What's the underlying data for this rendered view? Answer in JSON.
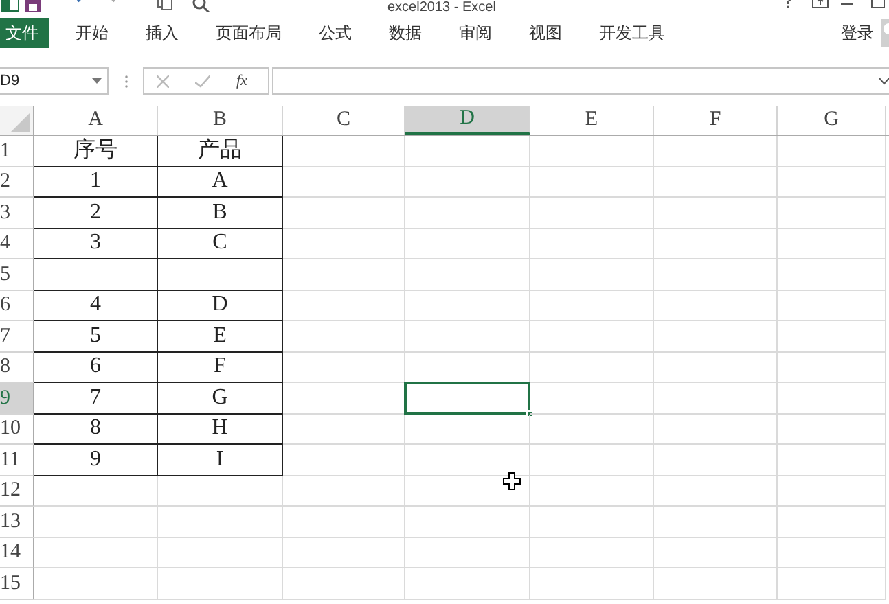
{
  "window": {
    "title": "excel2013 - Excel"
  },
  "ribbon": {
    "tabs": [
      {
        "label": "文件",
        "selected": true
      },
      {
        "label": "开始",
        "selected": false
      },
      {
        "label": "插入",
        "selected": false
      },
      {
        "label": "页面布局",
        "selected": false
      },
      {
        "label": "公式",
        "selected": false
      },
      {
        "label": "数据",
        "selected": false
      },
      {
        "label": "审阅",
        "selected": false
      },
      {
        "label": "视图",
        "selected": false
      },
      {
        "label": "开发工具",
        "selected": false
      }
    ],
    "login": "登录"
  },
  "formula_bar": {
    "name_box": "D9",
    "fx": "fx"
  },
  "sheet": {
    "columns": [
      {
        "label": "A",
        "selected": false
      },
      {
        "label": "B",
        "selected": false
      },
      {
        "label": "C",
        "selected": false
      },
      {
        "label": "D",
        "selected": true
      },
      {
        "label": "E",
        "selected": false
      },
      {
        "label": "F",
        "selected": false
      },
      {
        "label": "G",
        "selected": false
      }
    ],
    "rows": [
      {
        "label": "1",
        "selected": false,
        "bordered": true,
        "cells": [
          "序号",
          "产品"
        ]
      },
      {
        "label": "2",
        "selected": false,
        "bordered": true,
        "cells": [
          "1",
          "A"
        ]
      },
      {
        "label": "3",
        "selected": false,
        "bordered": true,
        "cells": [
          "2",
          "B"
        ]
      },
      {
        "label": "4",
        "selected": false,
        "bordered": true,
        "cells": [
          "3",
          "C"
        ]
      },
      {
        "label": "5",
        "selected": false,
        "bordered": true,
        "cells": []
      },
      {
        "label": "6",
        "selected": false,
        "bordered": true,
        "cells": [
          "4",
          "D"
        ]
      },
      {
        "label": "7",
        "selected": false,
        "bordered": true,
        "cells": [
          "5",
          "E"
        ]
      },
      {
        "label": "8",
        "selected": false,
        "bordered": true,
        "cells": [
          "6",
          "F"
        ]
      },
      {
        "label": "9",
        "selected": true,
        "bordered": true,
        "cells": [
          "7",
          "G"
        ]
      },
      {
        "label": "10",
        "selected": false,
        "bordered": true,
        "cells": [
          "8",
          "H"
        ]
      },
      {
        "label": "11",
        "selected": false,
        "bordered": true,
        "cells": [
          "9",
          "I"
        ]
      },
      {
        "label": "12",
        "selected": false,
        "bordered": false,
        "cells": []
      },
      {
        "label": "13",
        "selected": false,
        "bordered": false,
        "cells": []
      },
      {
        "label": "14",
        "selected": false,
        "bordered": false,
        "cells": []
      },
      {
        "label": "15",
        "selected": false,
        "bordered": false,
        "cells": []
      }
    ]
  }
}
